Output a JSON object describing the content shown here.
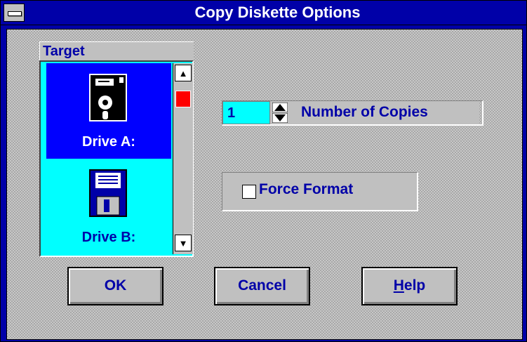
{
  "window": {
    "title": "Copy Diskette Options"
  },
  "target": {
    "label": "Target",
    "items": [
      {
        "label": "Drive A:",
        "icon": "floppy-disk-5-25-icon",
        "selected": true
      },
      {
        "label": "Drive B:",
        "icon": "floppy-disk-3-5-icon",
        "selected": false
      }
    ]
  },
  "copies": {
    "value": "1",
    "label": "Number of Copies"
  },
  "force_format": {
    "label": "Force Format",
    "checked": false
  },
  "buttons": {
    "ok": "OK",
    "cancel": "Cancel",
    "help_first": "H",
    "help_rest": "elp"
  },
  "colors": {
    "title_bar": "#0000a8",
    "selection": "#0000ff",
    "list_background": "#00ffff",
    "label_text": "#0000a8",
    "scroll_thumb": "#ff0000"
  }
}
